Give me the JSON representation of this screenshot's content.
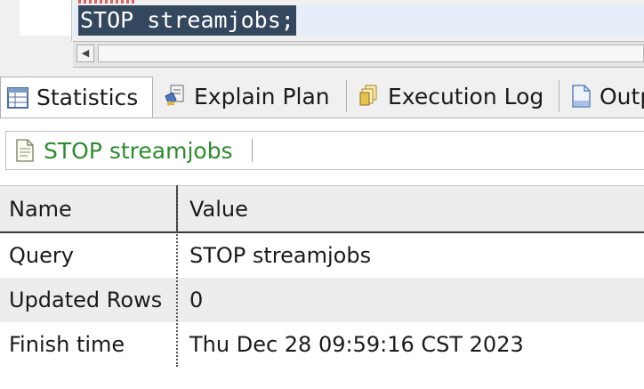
{
  "editor": {
    "code_text": "STOP streamjobs;"
  },
  "tabs": [
    {
      "label": "Statistics",
      "icon": "statistics-table-icon",
      "active": true
    },
    {
      "label": "Explain Plan",
      "icon": "explain-plan-icon",
      "active": false
    },
    {
      "label": "Execution Log",
      "icon": "execution-log-icon",
      "active": false
    },
    {
      "label": "Output",
      "icon": "output-document-icon",
      "active": false
    }
  ],
  "query_bar": {
    "label": "STOP streamjobs",
    "icon": "sql-document-icon"
  },
  "grid": {
    "columns": [
      "Name",
      "Value"
    ],
    "rows": [
      {
        "name": "Query",
        "value": "STOP streamjobs"
      },
      {
        "name": "Updated Rows",
        "value": "0"
      },
      {
        "name": "Finish time",
        "value": "Thu Dec 28 09:59:16 CST 2023"
      }
    ]
  },
  "colors": {
    "selection_bg": "#33475e",
    "query_link": "#2e8b2e",
    "current_line": "#e8eef9"
  }
}
